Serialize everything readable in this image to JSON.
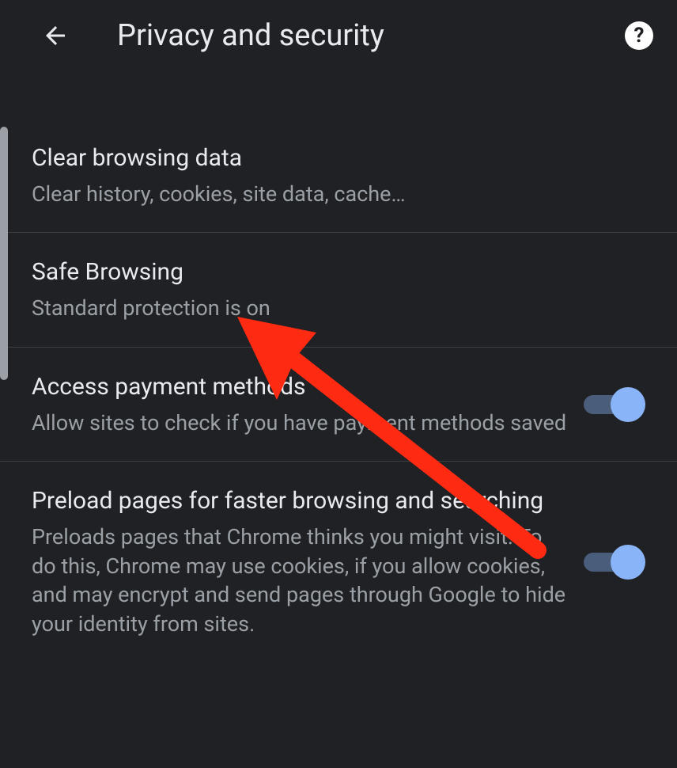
{
  "header": {
    "title": "Privacy and security"
  },
  "items": [
    {
      "title": "Clear browsing data",
      "subtitle": "Clear history, cookies, site data, cache…"
    },
    {
      "title": "Safe Browsing",
      "subtitle": "Standard protection is on"
    },
    {
      "title": "Access payment methods",
      "subtitle": "Allow sites to check if you have payment methods saved"
    },
    {
      "title": "Preload pages for faster browsing and searching",
      "subtitle": "Preloads pages that Chrome thinks you might visit. To do this, Chrome may use cookies, if you allow cookies, and may encrypt and send pages through Google to hide your identity from sites."
    }
  ]
}
